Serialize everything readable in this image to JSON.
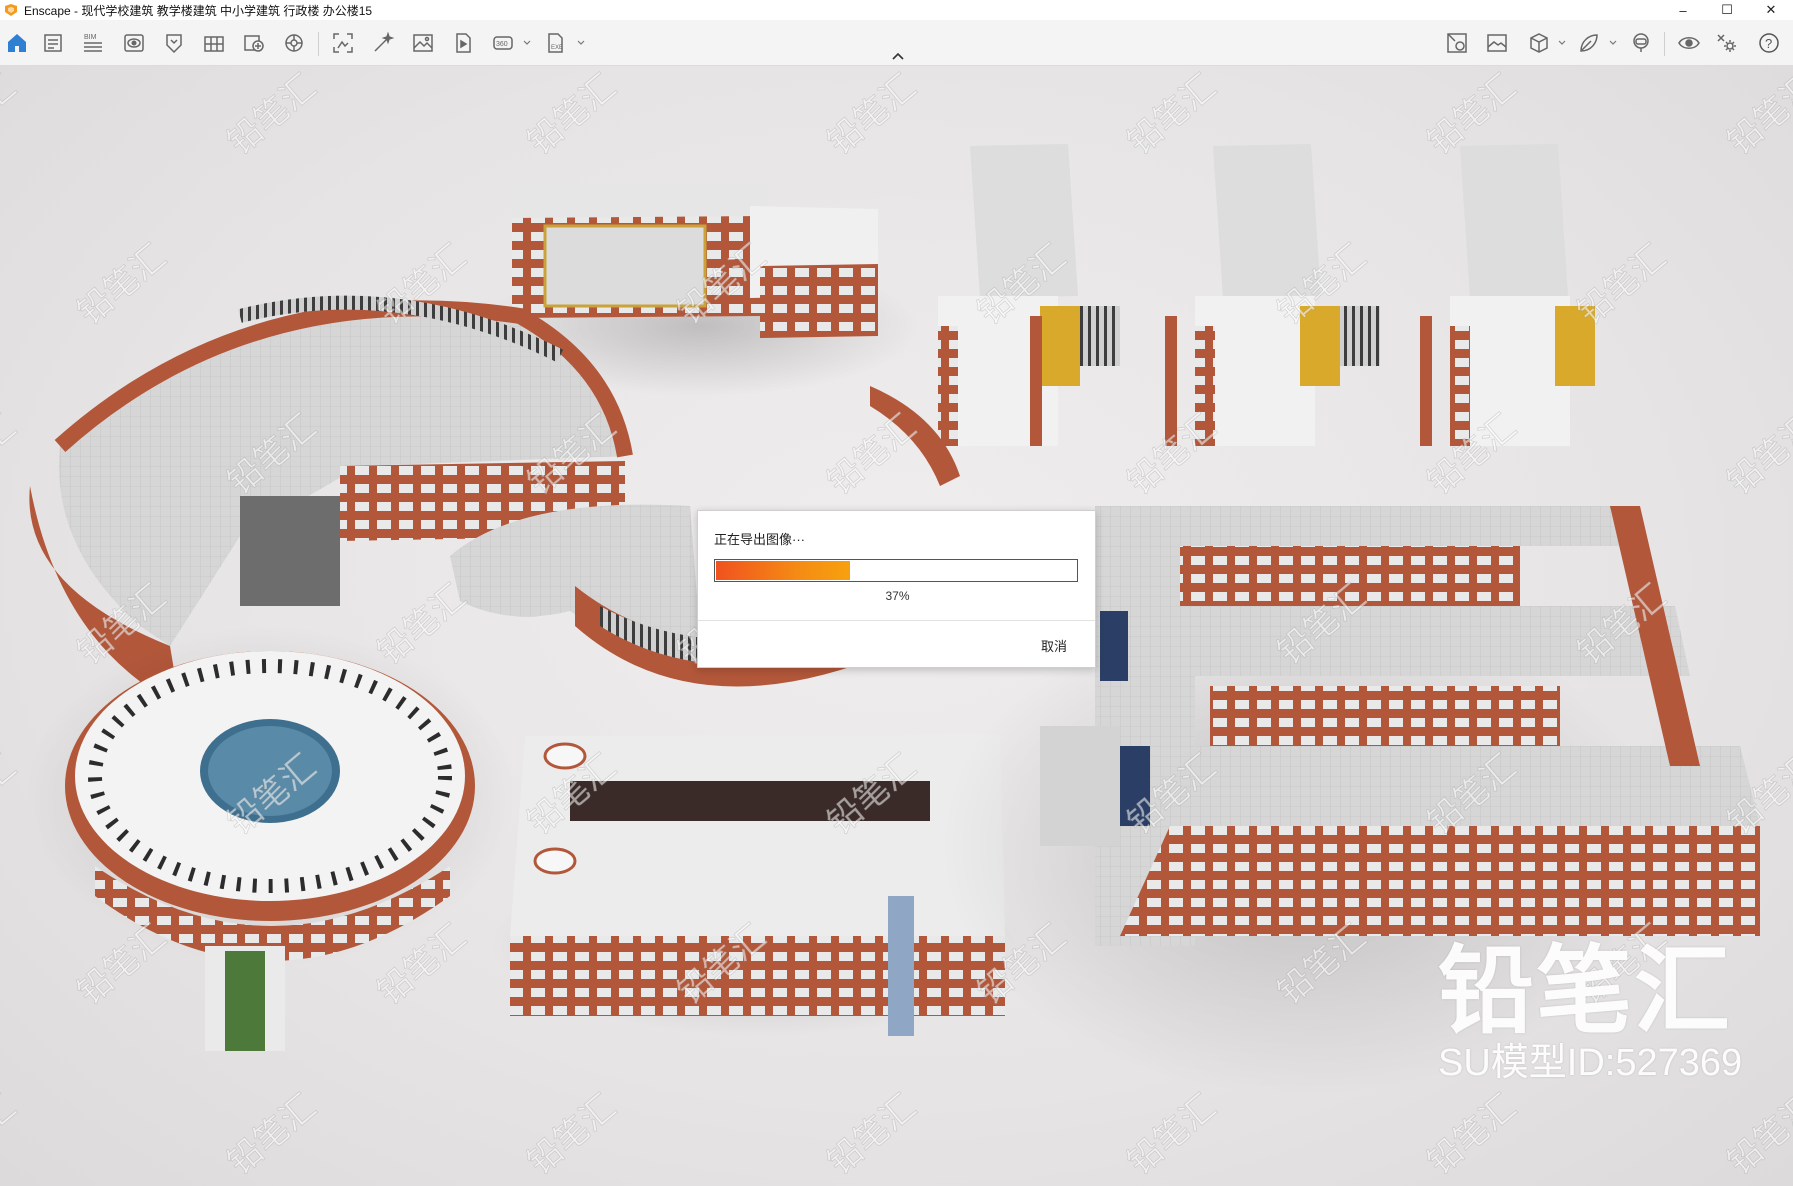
{
  "window": {
    "title": "Enscape - 现代学校建筑 教学楼建筑 中小学建筑 行政楼 办公楼15",
    "controls": {
      "minimize": "–",
      "maximize": "☐",
      "close": "✕"
    }
  },
  "toolbar": {
    "left_icons": [
      "home-icon",
      "project-icon",
      "bim-icon",
      "visual-settings-icon",
      "asset-library-icon",
      "material-editor-icon",
      "add-view-icon",
      "panorama-icon",
      "screenshot-icon",
      "batch-render-icon",
      "image-icon",
      "video-icon",
      "360-icon",
      "export-icon"
    ],
    "bim_label": "BIM",
    "right_icons": [
      "sync-views-icon",
      "gallery-icon",
      "cube-icon",
      "feedback-icon",
      "vr-headset-icon",
      "live-update-icon",
      "settings-icon",
      "help-icon"
    ],
    "help_label": "?"
  },
  "dialog": {
    "title": "正在导出图像···",
    "progress_fraction": 0.37,
    "progress_text": "37%",
    "cancel_label": "取消"
  },
  "watermark": {
    "brand": "铅笔汇",
    "model_id": "SU模型ID:527369",
    "tile_text": "铅笔汇"
  },
  "colors": {
    "accent_blue": "#2f7fd3",
    "brick": "#b2573a",
    "progress_start": "#f0521f",
    "progress_end": "#f7a10f"
  }
}
